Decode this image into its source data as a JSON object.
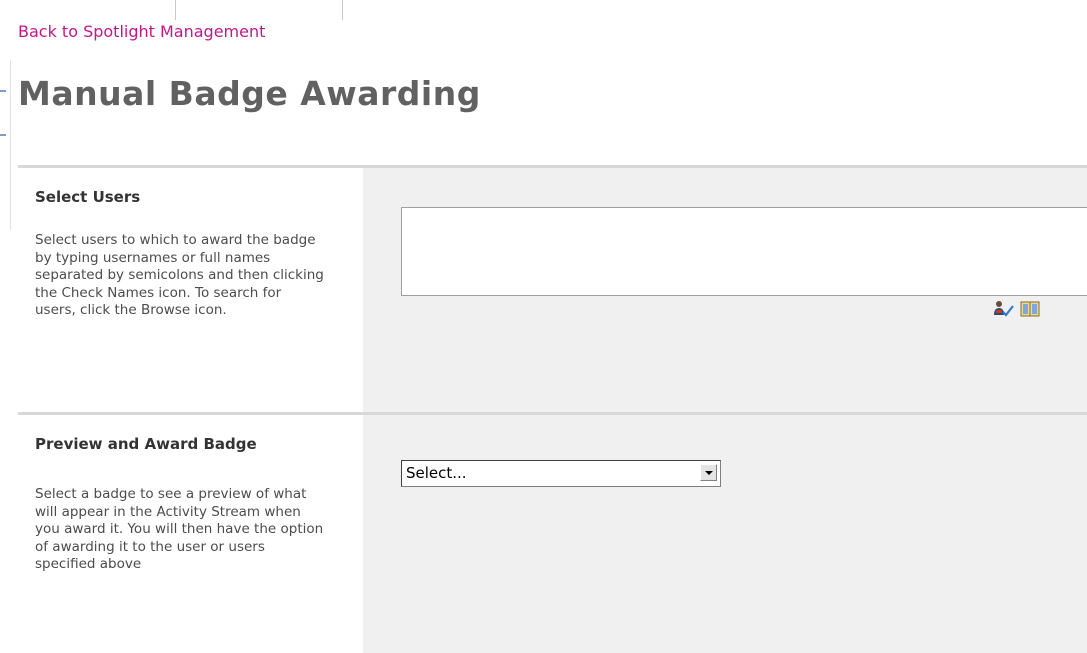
{
  "nav": {
    "back_link": "Back to Spotlight Management"
  },
  "page": {
    "title": "Manual Badge Awarding"
  },
  "sections": {
    "select_users": {
      "heading": "Select Users",
      "description": "Select users to which to award the badge by typing usernames or full names separated by semicolons and then clicking the Check Names icon.  To search for users, click the Browse icon.",
      "input_value": "",
      "icons": [
        "check-names-icon",
        "browse-icon"
      ]
    },
    "preview_award": {
      "heading": "Preview and Award Badge",
      "description": "Select a badge to see a preview of what will appear in the Activity Stream when you award it.  You will then have the option of awarding it to the user or users specified above",
      "select_value": "Select..."
    }
  },
  "colors": {
    "link": "#c0188a",
    "title": "#616161",
    "panel_bg": "#f0f0f0",
    "divider": "#d8d8d8"
  }
}
